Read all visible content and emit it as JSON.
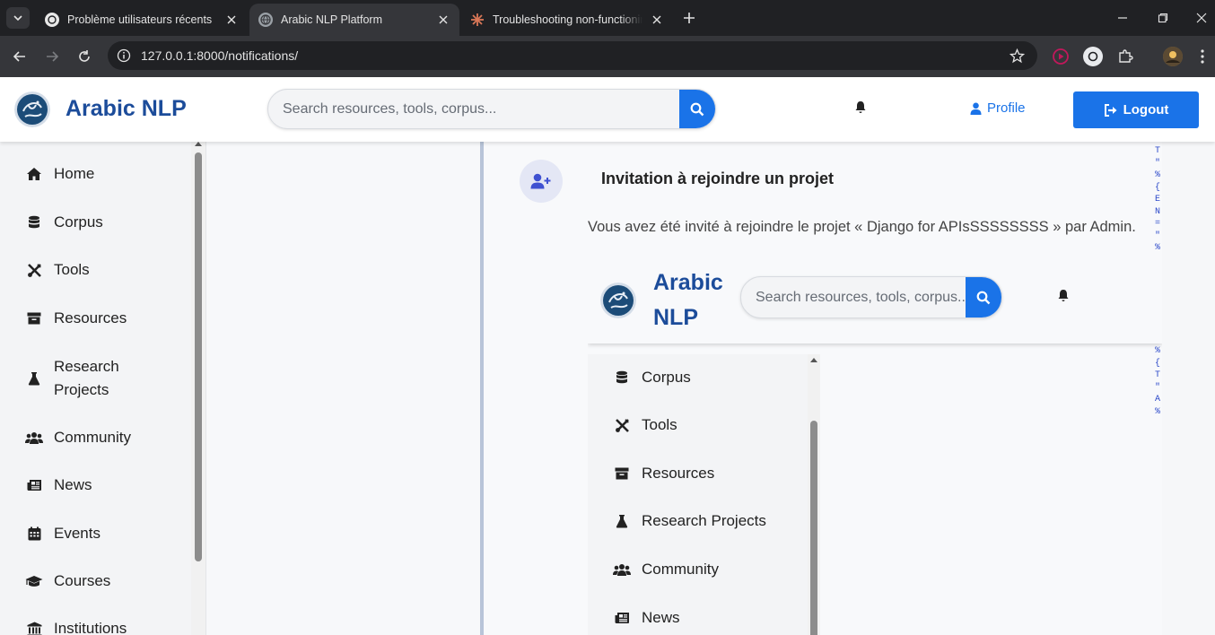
{
  "browser": {
    "tabs": [
      {
        "title": "Problème utilisateurs récents",
        "active": false
      },
      {
        "title": "Arabic NLP Platform",
        "active": true
      },
      {
        "title": "Troubleshooting non-functionin",
        "active": false
      }
    ],
    "url": "127.0.0.1:8000/notifications/"
  },
  "header": {
    "brand": "Arabic NLP",
    "search_placeholder": "Search resources, tools, corpus...",
    "profile_label": "Profile",
    "logout_label": "Logout"
  },
  "sidebar": {
    "items": [
      {
        "label": "Home",
        "icon": "home-icon"
      },
      {
        "label": "Corpus",
        "icon": "database-icon"
      },
      {
        "label": "Tools",
        "icon": "tools-icon"
      },
      {
        "label": "Resources",
        "icon": "archive-icon"
      },
      {
        "label": "Research Projects",
        "icon": "flask-icon"
      },
      {
        "label": "Community",
        "icon": "users-icon"
      },
      {
        "label": "News",
        "icon": "newspaper-icon"
      },
      {
        "label": "Events",
        "icon": "calendar-icon"
      },
      {
        "label": "Courses",
        "icon": "graduation-cap-icon"
      },
      {
        "label": "Institutions",
        "icon": "institution-icon"
      }
    ]
  },
  "notification": {
    "title": "Invitation à rejoindre un projet",
    "message": "Vous avez été invité à rejoindre le projet « Django for APIsSSSSSSSS » par Admin."
  },
  "embedded": {
    "brand": "Arabic NLP",
    "search_placeholder": "Search resources, tools, corpus...",
    "sidebar_items": [
      {
        "label": "Corpus",
        "icon": "database-icon"
      },
      {
        "label": "Tools",
        "icon": "tools-icon"
      },
      {
        "label": "Resources",
        "icon": "archive-icon"
      },
      {
        "label": "Research Projects",
        "icon": "flask-icon"
      },
      {
        "label": "Community",
        "icon": "users-icon"
      },
      {
        "label": "News",
        "icon": "newspaper-icon"
      }
    ]
  },
  "code_fragments": {
    "top": [
      "T",
      "\"",
      "%",
      "{",
      "E",
      "N",
      "=",
      "\"",
      "%"
    ],
    "bottom": [
      "%",
      "{",
      "T",
      "\"",
      "A",
      "%"
    ]
  },
  "colors": {
    "accent": "#1a73e8",
    "brand": "#1c4c9a",
    "browser_bg": "#202124"
  }
}
